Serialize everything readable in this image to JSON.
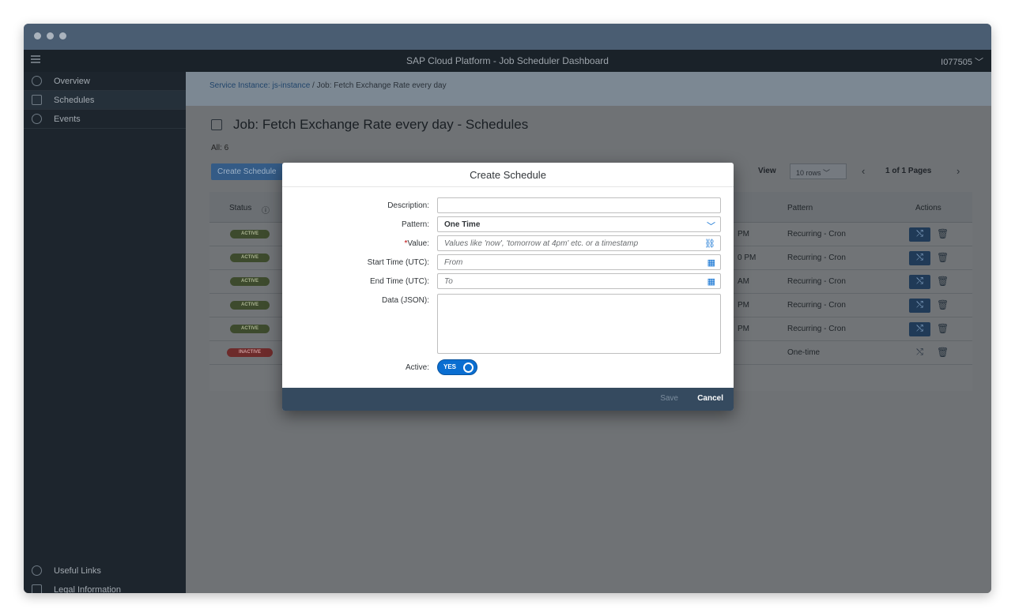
{
  "shell": {
    "title": "SAP Cloud Platform - Job Scheduler Dashboard",
    "user": "I077505 ﹀"
  },
  "sidebar": {
    "items": [
      {
        "label": "Overview"
      },
      {
        "label": "Schedules"
      },
      {
        "label": "Events"
      }
    ],
    "footer": [
      {
        "label": "Useful Links"
      },
      {
        "label": "Legal Information"
      }
    ]
  },
  "breadcrumb": {
    "link": "Service Instance: js-instance",
    "sep": " / ",
    "current": "Job: Fetch Exchange Rate every day"
  },
  "page": {
    "title": "Job: Fetch Exchange Rate every day - Schedules",
    "count": "All: 6",
    "create_button": "Create Schedule",
    "view_label": "View",
    "view_value": "10 rows ﹀",
    "prev": "‹",
    "next": "›",
    "pages": "1 of 1 Pages"
  },
  "table": {
    "headers": {
      "status": "Status",
      "pattern": "Pattern",
      "actions": "Actions"
    },
    "rows": [
      {
        "status": "ACTIVE",
        "time": "PM",
        "pattern": "Recurring - Cron"
      },
      {
        "status": "ACTIVE",
        "time": "0 PM",
        "pattern": "Recurring - Cron"
      },
      {
        "status": "ACTIVE",
        "time": "AM",
        "pattern": "Recurring - Cron"
      },
      {
        "status": "ACTIVE",
        "time": "PM",
        "pattern": "Recurring - Cron"
      },
      {
        "status": "ACTIVE",
        "time": "PM",
        "pattern": "Recurring - Cron"
      },
      {
        "status": "INACTIVE",
        "time": "",
        "pattern": "One-time"
      }
    ]
  },
  "dialog": {
    "title": "Create Schedule",
    "description_label": "Description:",
    "description_value": "",
    "pattern_label": "Pattern:",
    "pattern_value": "One Time",
    "value_required": "*",
    "value_label": "Value:",
    "value_placeholder": "Values like 'now', 'tomorrow at 4pm' etc. or a timestamp",
    "start_label": "Start Time (UTC):",
    "start_placeholder": "From",
    "end_label": "End Time (UTC):",
    "end_placeholder": "To",
    "data_label": "Data (JSON):",
    "active_label": "Active:",
    "active_value": "YES",
    "save": "Save",
    "cancel": "Cancel"
  },
  "colors": {
    "accent": "#0a6ed1",
    "shell": "#1a2229",
    "footer": "#354a5f",
    "active_badge": "#3d4a2d",
    "inactive_badge": "#6d2b2b"
  },
  "icons": {
    "dialog_value": "link-icon",
    "dialog_dates": "calendar-icon",
    "dialog_pattern": "chevron-down-icon",
    "row_action": "run-icon",
    "row_delete": "trash-icon"
  }
}
